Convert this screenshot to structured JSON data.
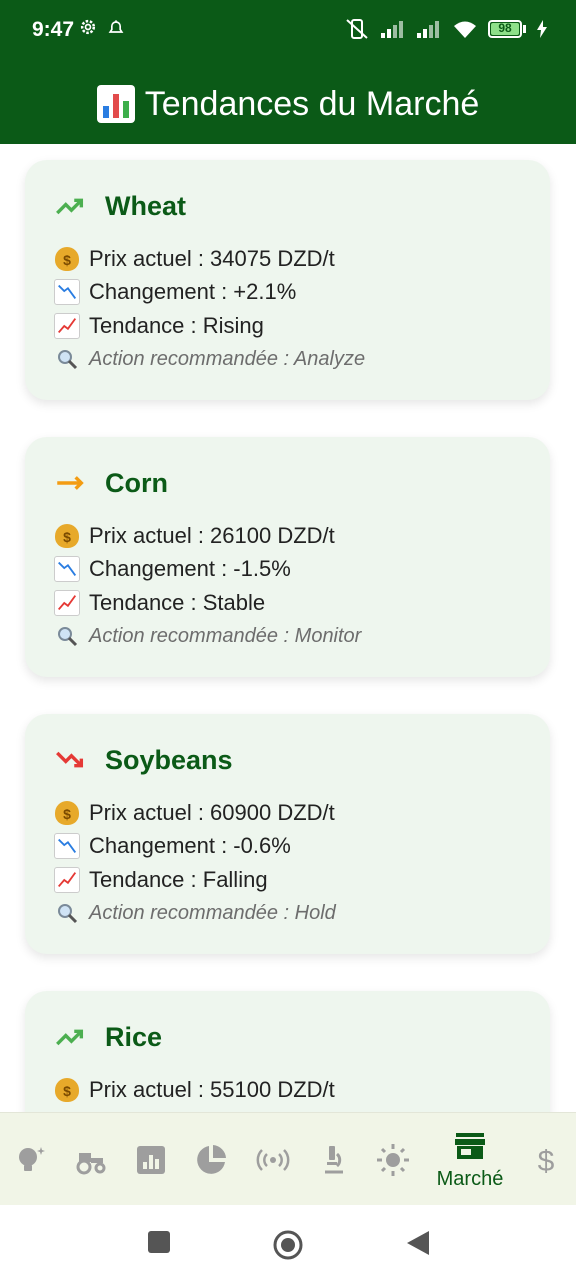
{
  "status_bar": {
    "time": "9:47",
    "battery": "98"
  },
  "app_bar": {
    "title": "Tendances du Marché"
  },
  "cards": [
    {
      "name": "Wheat",
      "trend_icon": "trending-up-icon",
      "trend_color": "#4caf50",
      "price": "💰 Prix actuel : 34075 DZD/t",
      "price_text": "Prix actuel : 34075 DZD/t",
      "change_text": "Changement : +2.1%",
      "trend_text": "Tendance : Rising",
      "action_text": "Action recommandée : Analyze"
    },
    {
      "name": "Corn",
      "trend_icon": "arrow-right-icon",
      "trend_color": "#f39c12",
      "price_text": "Prix actuel : 26100 DZD/t",
      "change_text": "Changement : -1.5%",
      "trend_text": "Tendance : Stable",
      "action_text": "Action recommandée : Monitor"
    },
    {
      "name": "Soybeans",
      "trend_icon": "trending-down-icon",
      "trend_color": "#e53935",
      "price_text": "Prix actuel : 60900 DZD/t",
      "change_text": "Changement : -0.6%",
      "trend_text": "Tendance : Falling",
      "action_text": "Action recommandée : Hold"
    },
    {
      "name": "Rice",
      "trend_icon": "trending-up-icon",
      "trend_color": "#4caf50",
      "price_text": "Prix actuel : 55100 DZD/t"
    }
  ],
  "bottom_nav": {
    "items": [
      {
        "icon": "lightbulb-icon"
      },
      {
        "icon": "tractor-icon"
      },
      {
        "icon": "bar-chart-icon"
      },
      {
        "icon": "pie-chart-icon"
      },
      {
        "icon": "sensors-icon"
      },
      {
        "icon": "microscope-icon"
      },
      {
        "icon": "sun-icon"
      },
      {
        "icon": "store-icon",
        "label": "Marché",
        "active": true
      },
      {
        "icon": "dollar-icon"
      }
    ]
  }
}
